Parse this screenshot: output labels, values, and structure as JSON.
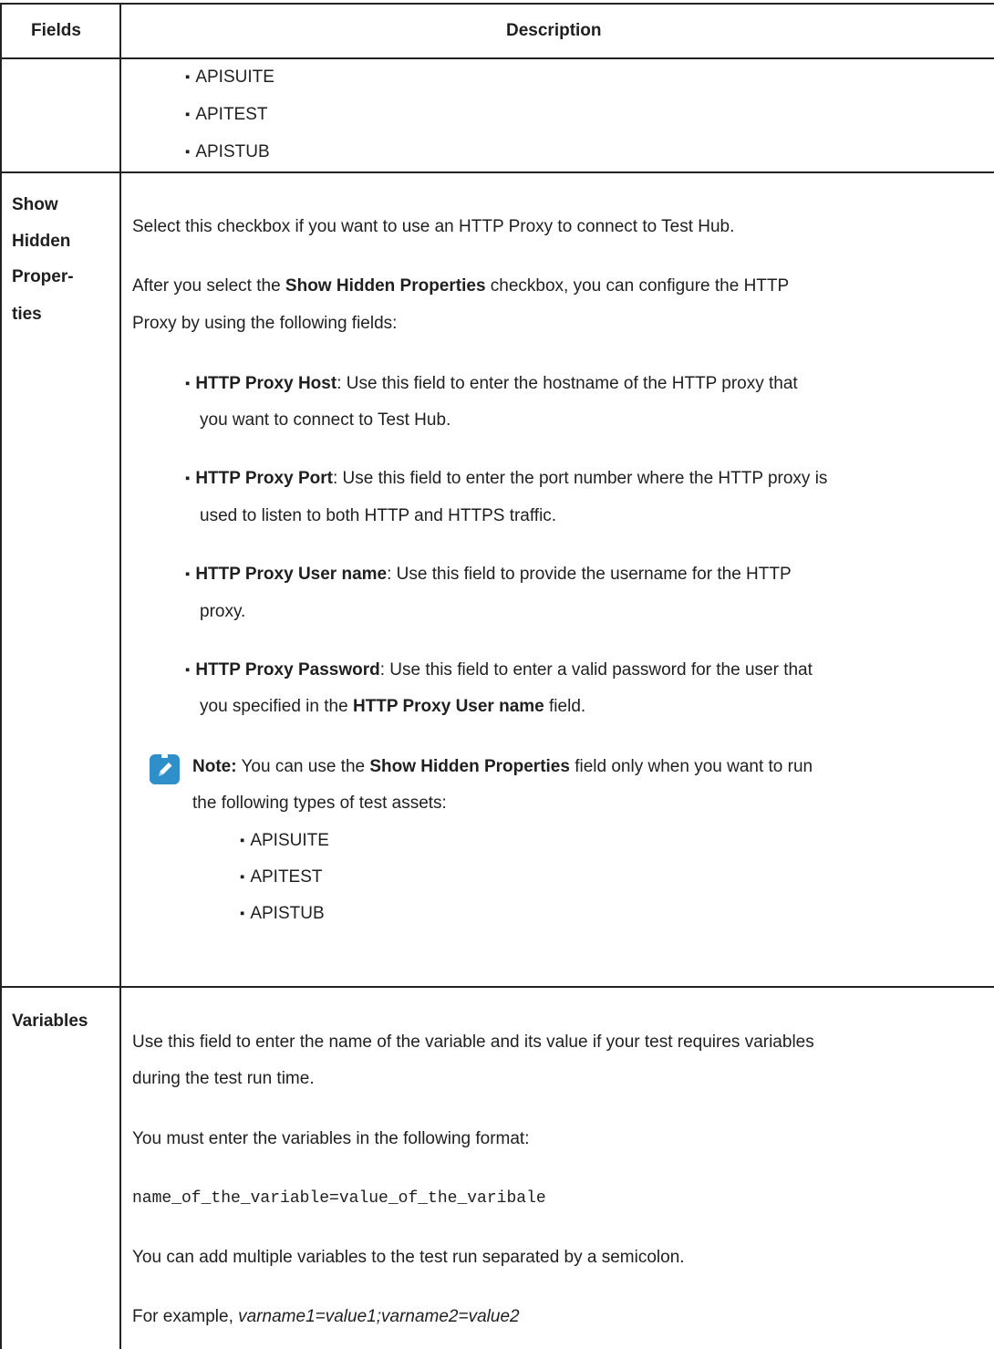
{
  "table": {
    "headers": {
      "fields": "Fields",
      "description": "Description"
    },
    "row0": {
      "items": [
        "APISUITE",
        "APITEST",
        "APISTUB"
      ]
    },
    "row1": {
      "field_line1": "Show",
      "field_line2": "Hidden",
      "field_line3": "Proper-",
      "field_line4": "ties",
      "p1": "Select this checkbox if you want to use an HTTP Proxy to connect to Test Hub.",
      "p2_pre": "After you select the ",
      "p2_bold": "Show Hidden Properties",
      "p2_post": " checkbox, you can configure the HTTP",
      "p2_line2": "Proxy by using the following fields:",
      "b1_label": "HTTP Proxy Host",
      "b1_text": ": Use this field to enter the hostname of the HTTP proxy that",
      "b1_line2": "you want to connect to Test Hub.",
      "b2_label": "HTTP Proxy Port",
      "b2_text": ": Use this field to enter the port number where the HTTP proxy is",
      "b2_line2": "used to listen to both HTTP and HTTPS traffic.",
      "b3_label": "HTTP Proxy User name",
      "b3_text": ": Use this field to provide the username for the HTTP",
      "b3_line2": "proxy.",
      "b4_label": "HTTP Proxy Password",
      "b4_text": ": Use this field to enter a valid password for the user that",
      "b4_line2_pre": "you specified in the ",
      "b4_line2_bold": "HTTP Proxy User name",
      "b4_line2_post": " field.",
      "note_label": "Note:",
      "note_pre": " You can use the ",
      "note_bold": "Show Hidden Properties",
      "note_post": " field only when you want to run",
      "note_line2": "the following types of test assets:",
      "note_items": [
        "APISUITE",
        "APITEST",
        "APISTUB"
      ],
      "note_icon": "pencil-icon",
      "note_icon_color": "#2f8fc8"
    },
    "row2": {
      "field": "Variables",
      "p1": "Use this field to enter the name of the variable and its value if your test requires variables",
      "p1_line2": "during the test run time.",
      "p2": "You must enter the variables in the following format:",
      "code": "name_of_the_variable=value_of_the_varibale",
      "p3": "You can add multiple variables to the test run separated by a semicolon.",
      "p4_pre": "For example, ",
      "p4_italic": "varname1=value1;varname2=value2"
    }
  }
}
